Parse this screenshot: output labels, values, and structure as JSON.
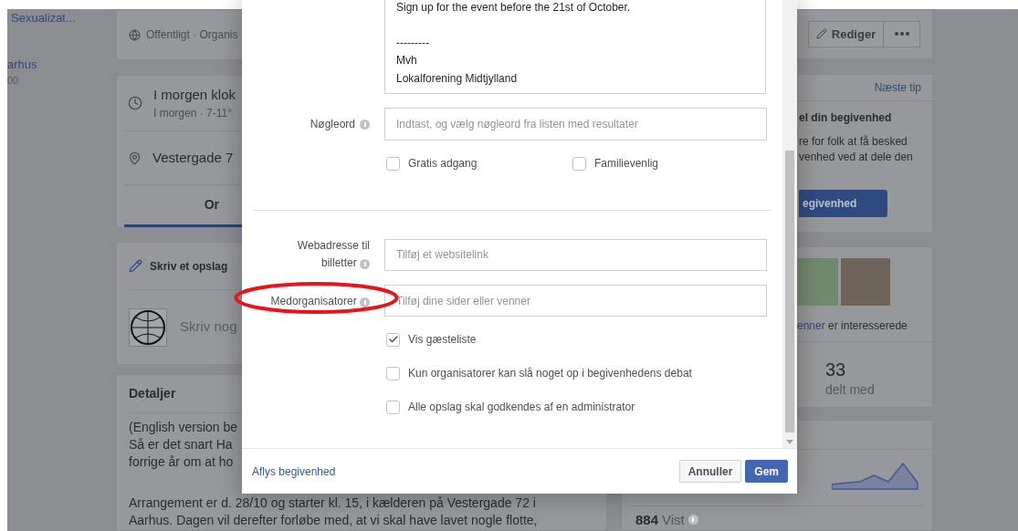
{
  "sidebar": {
    "items": [
      {
        "text": "Sexualizat...",
        "kind": "link"
      },
      {
        "text": "arhus",
        "kind": "link"
      },
      {
        "text": "00",
        "kind": "meta"
      }
    ]
  },
  "event": {
    "privacy": "Offentligt · Organis",
    "time": "I morgen klok",
    "time_detail": "I morgen · 7-11°",
    "location": "Vestergade 7",
    "tab": {
      "label": "Or",
      "selected": true
    }
  },
  "composer": {
    "title": "Skriv et opslag",
    "prompt": "Skriv nog"
  },
  "details": {
    "title": "Detaljer",
    "paragraphs": [
      [
        "(English version be",
        "Så er det snart Ha",
        "forrige år om at ho"
      ],
      [
        "Arrangement er d. 28/10 og starter kl. 15, i kælderen på Vestergade 72 i",
        "Aarhus. Dagen vil derefter forløbe med, at vi skal have lavet nogle flotte,"
      ]
    ]
  },
  "dialog": {
    "description_paragraphs": [
      [
        "Sign up for the event before the 21st of October."
      ],
      [
        "---------",
        "Mvh",
        "Lokalforening Midtjylland"
      ]
    ],
    "keywords": {
      "label": "Nøgleord",
      "placeholder": "Indtast, og vælg nøgleord fra listen med resultater"
    },
    "flags": [
      {
        "label": "Gratis adgang",
        "checked": false
      },
      {
        "label": "Familievenlig",
        "checked": false
      }
    ],
    "fields": [
      {
        "label": "Webadresse til billetter",
        "placeholder": "Tilføj et websitelink",
        "highlighted": false
      },
      {
        "label": "Medorganisatorer",
        "placeholder": "Tilføj dine sider eller venner",
        "highlighted": true
      }
    ],
    "options": [
      {
        "label": "Vis gæsteliste",
        "checked": true
      },
      {
        "label": "Kun organisatorer kan slå noget op i begivenhedens debat",
        "checked": false
      },
      {
        "label": "Alle opslag skal godkendes af en administrator",
        "checked": false
      }
    ],
    "cancel_event": "Aflys begivenhed",
    "buttons": [
      {
        "label": "Annuller",
        "kind": "secondary"
      },
      {
        "label": "Gem",
        "kind": "primary"
      }
    ]
  },
  "right": {
    "edit": "Rediger",
    "tip": {
      "next": "Næste tip",
      "title": "el din begivenhed",
      "lines": [
        "re for folk at få besked",
        "venhed ved at dele den"
      ],
      "button": "egivenhed"
    },
    "friends": {
      "link": "enner",
      "text": "er interesserede"
    },
    "shared": {
      "value": "33",
      "label": "delt med"
    },
    "views": {
      "value": "884",
      "label": "Vist"
    }
  }
}
